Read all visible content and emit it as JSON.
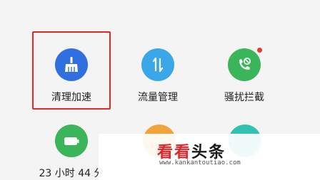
{
  "tiles": {
    "cleanup": {
      "label": "清理加速",
      "icon": "broom-icon",
      "color": "#2f6fe0"
    },
    "data_usage": {
      "label": "流量管理",
      "icon": "data-transfer-icon",
      "color": "#3aa8e8"
    },
    "harass_block": {
      "label": "骚扰拦截",
      "icon": "phone-block-icon",
      "color": "#3bb55a",
      "badge_color": "#e33b2f"
    },
    "battery": {
      "label": "23 小时 44 分",
      "icon": "battery-icon",
      "color": "#3bb55a"
    }
  },
  "watermark": {
    "title_red": "看看",
    "title_dark": "头条",
    "url": "www.kankantoutiao.com"
  },
  "colors": {
    "highlight_border": "#e02a2a",
    "partial_orange": "#f2a43a",
    "partial_teal": "#33c2b0"
  }
}
